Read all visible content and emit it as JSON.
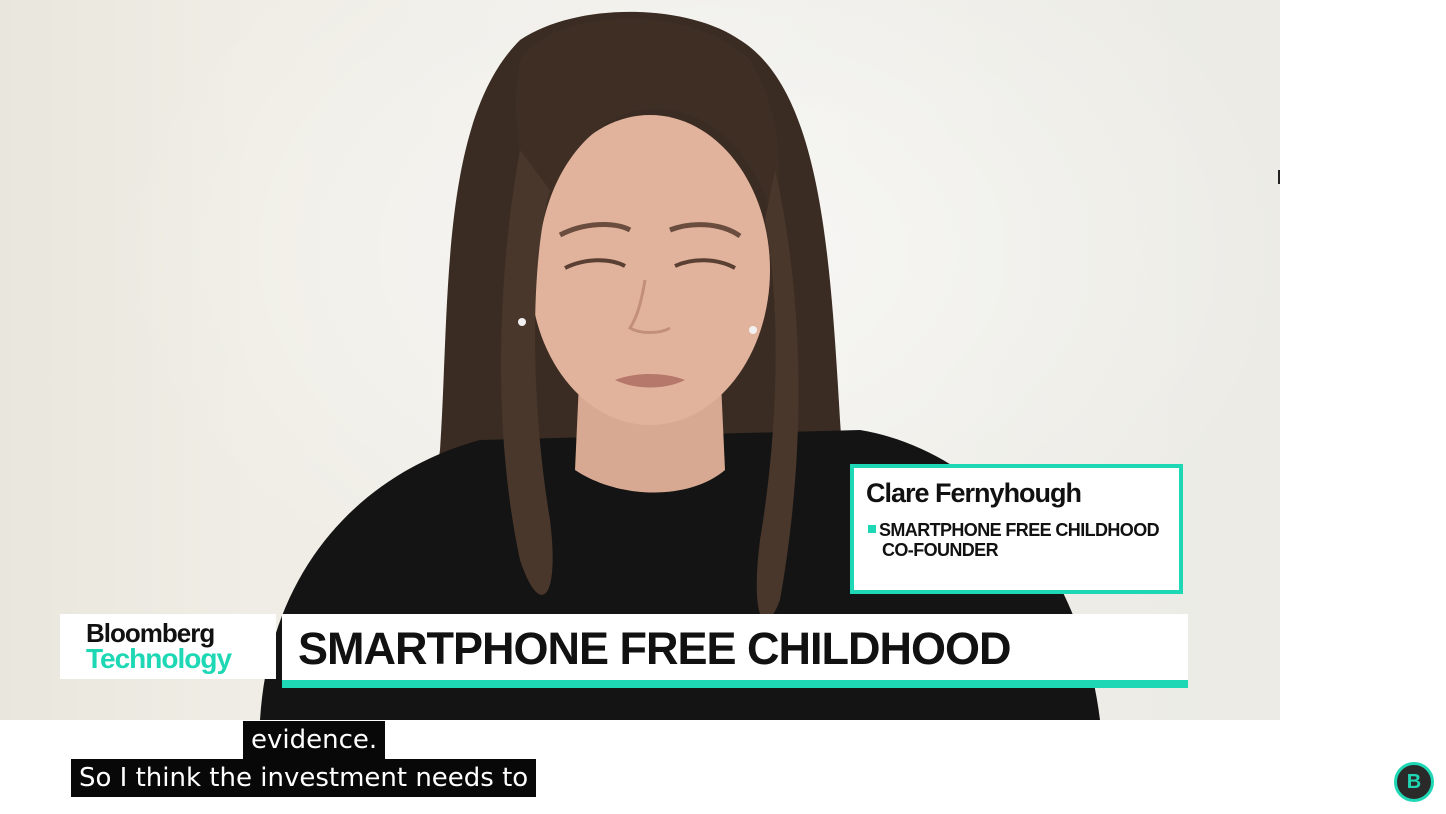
{
  "video": {
    "brand": {
      "line1": "Bloomberg",
      "line2": "Technology"
    },
    "headline": "SMARTPHONE FREE CHILDHOOD",
    "guest": {
      "name": "Clare Fernyhough",
      "role_line1": "SMARTPHONE FREE CHILDHOOD",
      "role_line2": "CO-FOUNDER"
    }
  },
  "captions": {
    "line1": "evidence.",
    "line2": "So I think the investment needs to"
  },
  "channel_badge": {
    "letter": "B"
  },
  "colors": {
    "accent": "#1ed7b4",
    "caption_bg": "#080808",
    "text_dark": "#111111"
  }
}
